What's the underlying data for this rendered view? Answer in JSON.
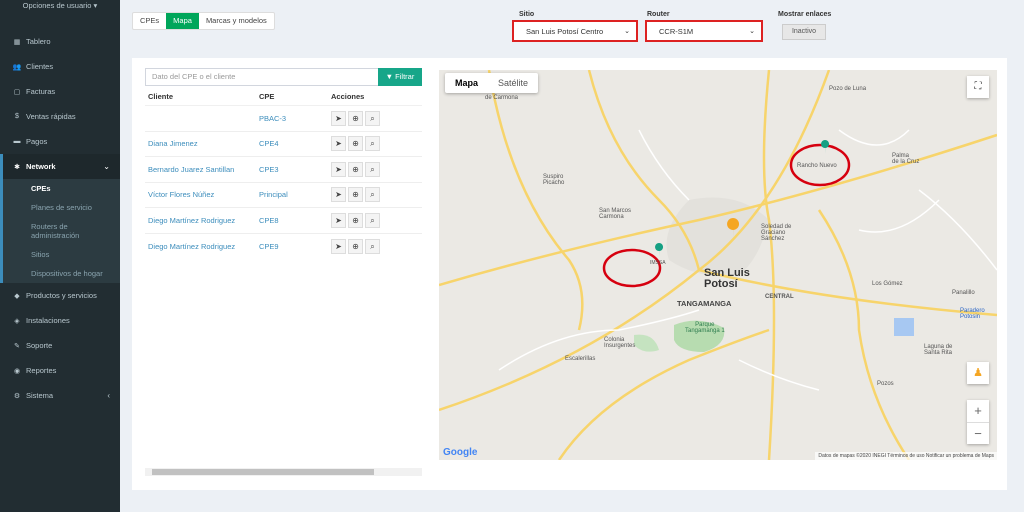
{
  "sidebar": {
    "user_options": "Opciones de usuario ▾",
    "items": [
      {
        "label": "Tablero",
        "icon": "dashboard-icon",
        "glyph": "▦"
      },
      {
        "label": "Clientes",
        "icon": "users-icon",
        "glyph": "👥"
      },
      {
        "label": "Facturas",
        "icon": "invoice-icon",
        "glyph": "▢"
      },
      {
        "label": "Ventas rápidas",
        "icon": "dollar-icon",
        "glyph": "$"
      },
      {
        "label": "Pagos",
        "icon": "payments-icon",
        "glyph": "▬"
      },
      {
        "label": "Network",
        "icon": "network-icon",
        "glyph": "✱"
      },
      {
        "label": "Productos y servicios",
        "icon": "products-icon",
        "glyph": "◆"
      },
      {
        "label": "Instalaciones",
        "icon": "install-icon",
        "glyph": "◈"
      },
      {
        "label": "Soporte",
        "icon": "wrench-icon",
        "glyph": "✎"
      },
      {
        "label": "Reportes",
        "icon": "reports-icon",
        "glyph": "◉"
      },
      {
        "label": "Sistema",
        "icon": "cogs-icon",
        "glyph": "⚙"
      }
    ],
    "network_sub": [
      "CPEs",
      "Planes de servicio",
      "Routers de administración",
      "Sitios",
      "Dispositivos de hogar"
    ]
  },
  "tabs": [
    "CPEs",
    "Mapa",
    "Marcas y modelos"
  ],
  "filters": {
    "sitio_label": "Sitio",
    "sitio_value": "San Luis Potosí Centro",
    "router_label": "Router",
    "router_value": "CCR-S1M",
    "links_label": "Mostrar enlaces",
    "links_value": "Inactivo"
  },
  "search": {
    "placeholder": "Dato del CPE o el cliente",
    "button": "Filtrar",
    "button_glyph": "▼"
  },
  "table": {
    "headers": [
      "Cliente",
      "CPE",
      "Acciones"
    ],
    "rows": [
      {
        "cliente": "",
        "cpe": "PBAC-3"
      },
      {
        "cliente": "Diana Jimenez",
        "cpe": "CPE4"
      },
      {
        "cliente": "Bernardo Juarez Santillan",
        "cpe": "CPE3"
      },
      {
        "cliente": "Víctor Flores Núñez",
        "cpe": "Principal"
      },
      {
        "cliente": "Diego Martínez Rodriguez",
        "cpe": "CPE8"
      },
      {
        "cliente": "Diego Martínez Rodriguez",
        "cpe": "CPE9"
      }
    ],
    "action_glyphs": [
      "➤",
      "⊕",
      "⌕"
    ]
  },
  "map": {
    "tab_map": "Mapa",
    "tab_sat": "Satélite",
    "google": "Google",
    "footer": "Datos de mapas ©2020 INEGI   Términos de uso   Notificar un problema de Maps",
    "fullscreen_glyph": "⛶",
    "pegman_glyph": "♟",
    "zoom_in": "+",
    "zoom_out": "−",
    "labels": {
      "pozo_luna": "Pozo de Luna",
      "carmona": "de Carmona",
      "palma": "Palma\nde la Cruz",
      "rancho": "Rancho Nuevo",
      "suspiro": "Suspiro\nPicacho",
      "sanmarcos": "San Marcos\nCarmona",
      "soledad": "Soledad de\nGraciano\nSánchez",
      "slp": "San Luis\nPotosí",
      "imssa": "IMSSA",
      "tangamanga": "TANGAMANGA",
      "central": "CENTRAL",
      "gomez": "Los Gómez",
      "panalillo": "Panalillo",
      "paradero": "Paradero\nPotosin",
      "parque": "Parque\nTangamanga 1",
      "colonia": "Colonia\nInsurgentes",
      "escalerillas": "Escalerillas",
      "laguna": "Laguna de\nSanta Rita",
      "pozos": "Pozos"
    }
  }
}
